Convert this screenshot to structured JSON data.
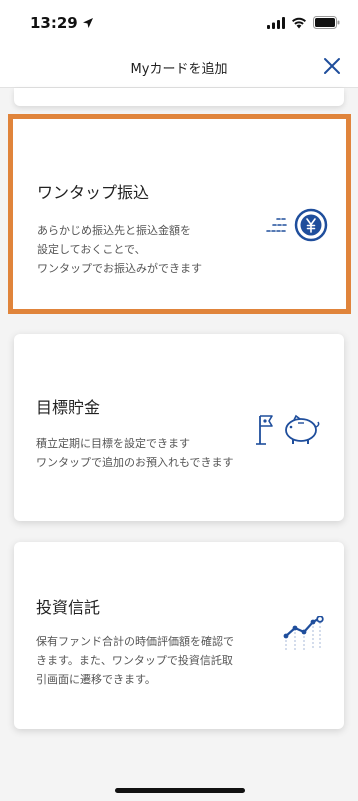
{
  "status": {
    "time": "13:29"
  },
  "header": {
    "title": "Myカードを追加",
    "close_icon": "close-icon"
  },
  "colors": {
    "accent": "#1f4e9c",
    "highlight": "#e0843b"
  },
  "cards": [
    {
      "title": "ワンタップ振込",
      "desc_lines": [
        "あらかじめ振込先と振込金額を",
        "設定しておくことで、",
        "ワンタップでお振込みができます"
      ],
      "icon": "yen-coin-icon",
      "selected": true
    },
    {
      "title": "目標貯金",
      "desc_lines": [
        "積立定期に目標を設定できます",
        "ワンタップで追加のお預入れもできます"
      ],
      "icon": "piggy-bank-icon",
      "selected": false
    },
    {
      "title": "投資信託",
      "desc_lines": [
        "保有ファンド合計の時価評価額を確認で",
        "きます。また、ワンタップで投資信託取",
        "引画面に遷移できます。"
      ],
      "icon": "line-chart-icon",
      "selected": false
    }
  ]
}
